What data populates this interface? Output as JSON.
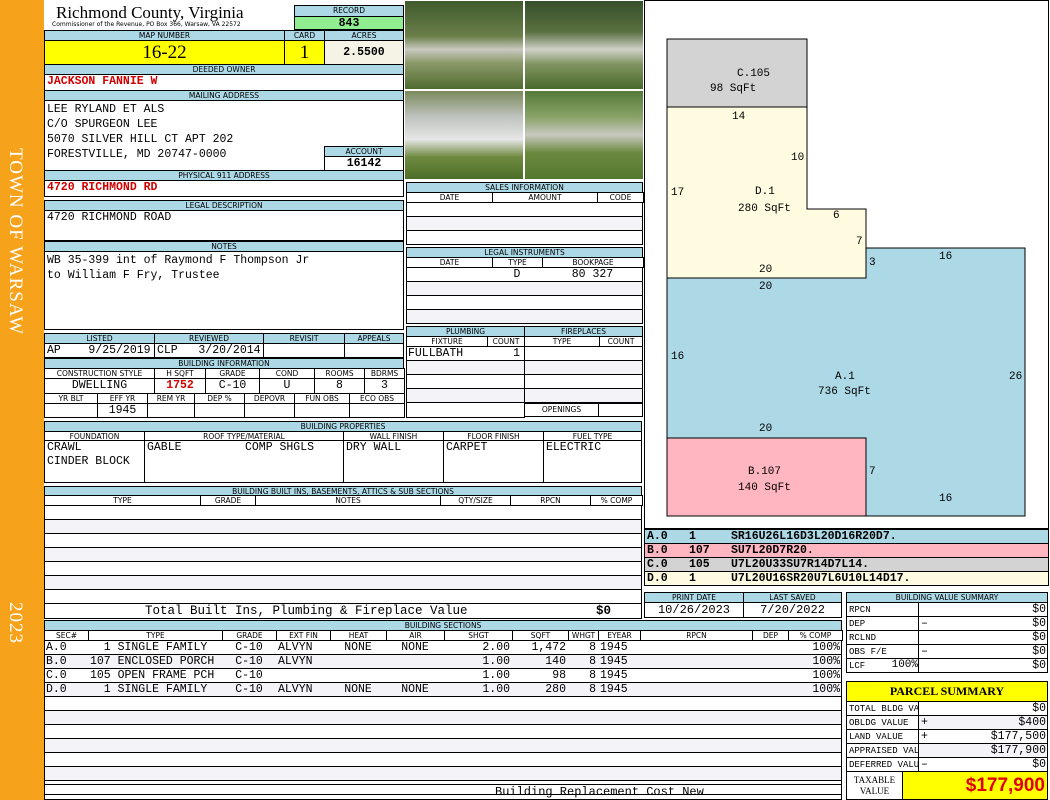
{
  "side": {
    "town": "TOWN OF WARSAW",
    "year": "2023"
  },
  "header": {
    "title": "Richmond County, Virginia",
    "subtitle": "Commissioner of the Revenue, PO Box 366, Warsaw, VA 22572",
    "record_label": "RECORD",
    "record": "843"
  },
  "parcel": {
    "map_label": "MAP NUMBER",
    "map": "16-22",
    "card_label": "CARD",
    "card": "1",
    "acres_label": "ACRES",
    "acres": "2.5500"
  },
  "owner": {
    "label": "DEEDED OWNER",
    "name": "JACKSON FANNIE W"
  },
  "mailing": {
    "label": "MAILING ADDRESS",
    "lines": [
      "LEE RYLAND ET ALS",
      "C/O SPURGEON LEE",
      "5070 SILVER HILL CT APT 202",
      "FORESTVILLE, MD 20747-0000"
    ],
    "account_label": "ACCOUNT",
    "account": "16142"
  },
  "physical": {
    "label": "PHYSICAL 911 ADDRESS",
    "value": "4720 RICHMOND RD"
  },
  "legal": {
    "label": "LEGAL DESCRIPTION",
    "value": "4720 RICHMOND ROAD"
  },
  "notes": {
    "label": "NOTES",
    "lines": [
      "WB 35-399 int of Raymond F Thompson Jr",
      "to William F Fry, Trustee"
    ]
  },
  "review": {
    "listed_label": "LISTED",
    "reviewed_label": "REVIEWED",
    "revisit_label": "REVISIT",
    "appeals_label": "APPEALS",
    "listed": "AP    9/25/2019",
    "reviewed": "CLP   3/20/2014",
    "revisit": "",
    "appeals": ""
  },
  "building_info": {
    "label": "BUILDING INFORMATION",
    "headers1": [
      "CONSTRUCTION STYLE",
      "H SQFT",
      "GRADE",
      "COND",
      "ROOMS",
      "BDRMS"
    ],
    "values1": [
      "DWELLING",
      "1752",
      "C-10",
      "U",
      "8",
      "3"
    ],
    "headers2": [
      "YR BLT",
      "EFF YR",
      "REM YR",
      "DEP %",
      "DEPOVR",
      "FUN OBS",
      "ECO OBS"
    ],
    "values2": [
      "",
      "1945",
      "",
      "",
      "",
      "",
      ""
    ]
  },
  "properties": {
    "label": "BUILDING PROPERTIES",
    "headers": [
      "FOUNDATION",
      "ROOF TYPE/MATERIAL",
      "WALL FINISH",
      "FLOOR FINISH",
      "FUEL TYPE"
    ],
    "foundation": "CRAWL\nCINDER BLOCK",
    "roof_type": "GABLE",
    "roof_material": "COMP SHGLS",
    "wall": "DRY WALL",
    "floor": "CARPET",
    "fuel": "ELECTRIC"
  },
  "builtins": {
    "label": "BUILDING BUILT INS, BASEMENTS, ATTICS & SUB SECTIONS",
    "headers": [
      "TYPE",
      "GRADE",
      "NOTES",
      "QTY/SIZE",
      "RPCN",
      "% COMP"
    ],
    "total_label": "Total Built Ins, Plumbing & Fireplace Value",
    "total": "$0"
  },
  "sections": {
    "label": "BUILDING SECTIONS",
    "headers": [
      "SEC#",
      "TYPE",
      "GRADE",
      "EXT FIN",
      "HEAT",
      "AIR",
      "SHGT",
      "SQFT",
      "WHGT",
      "EYEAR",
      "RPCN",
      "DEP",
      "% COMP"
    ],
    "rows": [
      [
        "A.0",
        "  1 SINGLE FAMILY",
        "C-10",
        "ALVYN",
        "NONE",
        "NONE",
        "2.00",
        "1,472",
        "8",
        "1945",
        "",
        "",
        "100%"
      ],
      [
        "B.0",
        "107 ENCLOSED PORCH",
        "C-10",
        "ALVYN",
        "",
        "",
        "1.00",
        "140",
        "8",
        "1945",
        "",
        "",
        "100%"
      ],
      [
        "C.0",
        "105 OPEN FRAME PCH",
        "C-10",
        "",
        "",
        "",
        "1.00",
        "98",
        "8",
        "1945",
        "",
        "",
        "100%"
      ],
      [
        "D.0",
        "  1 SINGLE FAMILY",
        "C-10",
        "ALVYN",
        "NONE",
        "NONE",
        "1.00",
        "280",
        "8",
        "1945",
        "",
        "",
        "100%"
      ]
    ],
    "footer": "Building Replacement Cost New"
  },
  "sales": {
    "label": "SALES INFORMATION",
    "headers": [
      "DATE",
      "AMOUNT",
      "CODE"
    ]
  },
  "instruments": {
    "label": "LEGAL INSTRUMENTS",
    "headers": [
      "DATE",
      "TYPE",
      "BOOKPAGE"
    ],
    "rows": [
      [
        "",
        "D",
        "80 327"
      ]
    ]
  },
  "plumbing": {
    "label": "PLUMBING",
    "headers": [
      "FIXTURE",
      "COUNT"
    ],
    "rows": [
      [
        "FULLBATH",
        "1"
      ]
    ]
  },
  "fireplaces": {
    "label": "FIREPLACES",
    "headers": [
      "TYPE",
      "COUNT"
    ],
    "openings_label": "OPENINGS"
  },
  "sketch": {
    "areas": [
      {
        "code": "C.105",
        "area": "98 SqFt",
        "color": "#d3d3d3"
      },
      {
        "code": "D.1",
        "area": "280 SqFt",
        "color": "#fffbe0"
      },
      {
        "code": "A.1",
        "area": "736 SqFt",
        "color": "#add8e6"
      },
      {
        "code": "B.107",
        "area": "140 SqFt",
        "color": "#ffb6c1"
      }
    ],
    "dimensions": [
      "14",
      "10",
      "17",
      "6",
      "7",
      "3",
      "20",
      "20",
      "16",
      "16",
      "26",
      "20",
      "7",
      "16"
    ]
  },
  "legend": [
    {
      "sec": "A.0",
      "code": "1",
      "path": "SR16U26L16D3L20D16R20D7.",
      "color": "#add8e6"
    },
    {
      "sec": "B.0",
      "code": "107",
      "path": "SU7L20D7R20.",
      "color": "#ffb6c1"
    },
    {
      "sec": "C.0",
      "code": "105",
      "path": "U7L20U33SU7R14D7L14.",
      "color": "#d3d3d3"
    },
    {
      "sec": "D.0",
      "code": "1",
      "path": "U7L20U16SR20U7L6U10L14D17.",
      "color": "#fffbe0"
    }
  ],
  "dates": {
    "print_label": "PRINT DATE",
    "print": "10/26/2023",
    "saved_label": "LAST SAVED",
    "saved": "7/20/2022"
  },
  "value_summary": {
    "label": "BUILDING VALUE SUMMARY",
    "rows": [
      {
        "label": "RPCN",
        "sign": "",
        "value": "$0"
      },
      {
        "label": "DEP",
        "sign": "–",
        "value": "$0"
      },
      {
        "label": "RCLND",
        "sign": "",
        "value": "$0"
      },
      {
        "label": "OBS F/E",
        "sign": "–",
        "value": "$0"
      },
      {
        "label": "LCF",
        "pct": "100%",
        "sign": "",
        "value": "$0"
      }
    ]
  },
  "parcel_summary": {
    "label": "PARCEL SUMMARY",
    "rows": [
      {
        "label": "TOTAL BLDG VALUE",
        "sign": "",
        "value": "$0"
      },
      {
        "label": "OBLDG VALUE",
        "sign": "+",
        "value": "$400"
      },
      {
        "label": "LAND VALUE",
        "sign": "+",
        "value": "$177,500"
      },
      {
        "label": "APPRAISED VALUE",
        "sign": "",
        "value": "$177,900"
      },
      {
        "label": "DEFERRED VALUE",
        "sign": "–",
        "value": "$0"
      }
    ],
    "taxable_label": "TAXABLE\nVALUE",
    "taxable": "$177,900"
  }
}
